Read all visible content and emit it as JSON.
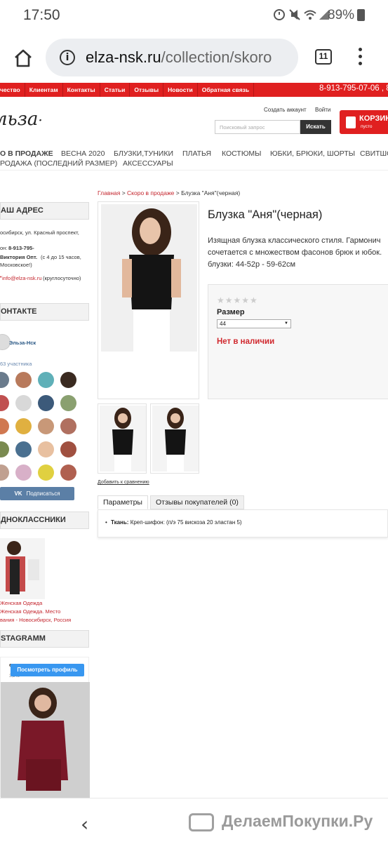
{
  "status": {
    "time": "17:50",
    "battery": "89%"
  },
  "browser": {
    "url_domain": "elza-nsk.ru",
    "url_path": "/collection/skoro",
    "tab_count": "11"
  },
  "topnav": {
    "items": [
      "чество",
      "Клиентам",
      "Контакты",
      "Статьи",
      "Отзывы",
      "Новости",
      "Обратная связь"
    ],
    "phone": "8-913-795-07-06 , 8-"
  },
  "header": {
    "logo": "льза",
    "create_account": "Создать аккаунт",
    "login": "Войти",
    "search_placeholder": "Поисковый запрос",
    "search_button": "Искать",
    "cart_label": "КОРЗИНА",
    "cart_status": "пусто"
  },
  "categories": {
    "row1": [
      "О В ПРОДАЖЕ",
      "ВЕСНА 2020",
      "БЛУЗКИ,ТУНИКИ",
      "ПЛАТЬЯ",
      "КОСТЮМЫ",
      "ЮБКИ, БРЮКИ, ШОРТЫ",
      "СВИТШО"
    ],
    "row2": [
      "РОДАЖА (ПОСЛЕДНИЙ РАЗМЕР)",
      "АКСЕССУАРЫ"
    ]
  },
  "sidebar": {
    "address_title": "АШ АДРЕС",
    "address_line": "осибирск, ул.  Красный проспект,",
    "phone_prefix": "он:",
    "phone_value": "8-913-795-",
    "contact_name": "Виктория  Опт.",
    "hours": "(с 4 до 15 часов,",
    "timezone": "Московское!)",
    "email": "info@elza-nsk.ru",
    "email_note": "(круглосуточно)",
    "vk_title": "ОНТАКТЕ",
    "vk_group": "Эльза-Нск",
    "vk_members": "63 участника",
    "vk_subscribe": "Подписаться",
    "ok_title": "ДНОКЛАССНИКИ",
    "ok_caption1": "Женская Одежда",
    "ok_caption2": "Женская Одежда. Место",
    "ok_caption3": "вания - Новосибирск, Россия",
    "ig_title": "STAGRAMM",
    "ig_user": "e",
    "ig_count": "3,145",
    "ig_button": "Посмотреть профиль"
  },
  "breadcrumb": {
    "home": "Главная",
    "section": "Скоро в продаже",
    "current": "Блузка \"Аня\"(черная)",
    "sep": " > "
  },
  "product": {
    "title": "Блузка \"Аня\"(черная)",
    "desc1": "Изящная блузка классического стиля. Гармонич",
    "desc2": "сочетается с множеством фасонов брюк и юбок.",
    "desc3": "блузки: 44-52р - 59-62см",
    "size_label": "Размер",
    "size_value": "44",
    "stock": "Нет в наличии",
    "compare": "Добавить к сравнению",
    "rating": 0
  },
  "tabs": {
    "params": "Параметры",
    "reviews": "Отзывы покупателей (0)"
  },
  "params": {
    "fabric_label": "Ткань:",
    "fabric_value": "Креп-шифон: (п/э 75 вискоза 20 эластан 5)"
  },
  "watermark": "ДелаемПокупки.Ру",
  "colors": {
    "brand_red": "#e02020",
    "link_red": "#c4262e",
    "stock_red": "#d0282e"
  }
}
